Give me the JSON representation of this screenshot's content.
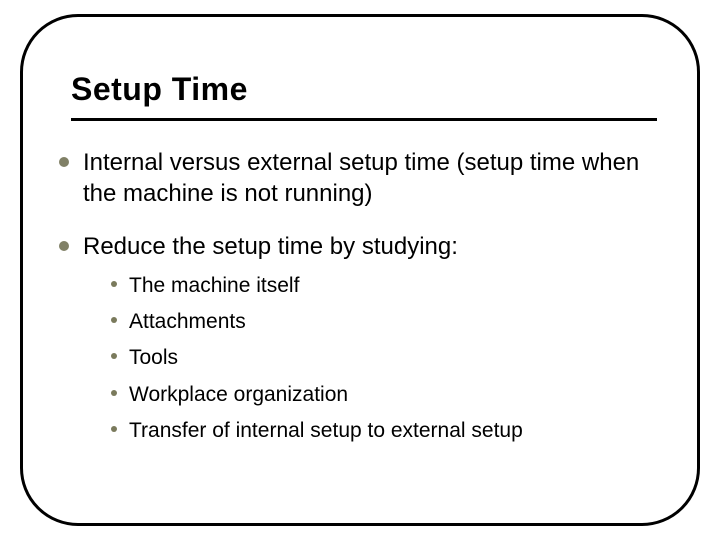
{
  "slide": {
    "title": "Setup Time",
    "bullets": [
      {
        "text": "Internal versus external setup time (setup time when the machine is not running)"
      },
      {
        "text": "Reduce the setup time by studying:",
        "sub": [
          "The machine itself",
          "Attachments",
          "Tools",
          "Workplace organization",
          "Transfer of internal setup to external setup"
        ]
      }
    ]
  }
}
